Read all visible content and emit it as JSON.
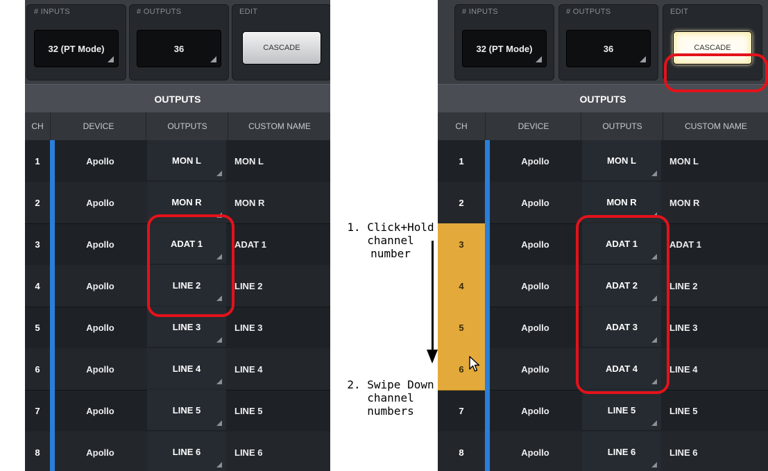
{
  "inputs": {
    "label": "# INPUTS",
    "value": "32 (PT Mode)"
  },
  "outputs_box": {
    "label": "# OUTPUTS",
    "value": "36"
  },
  "edit": {
    "label": "EDIT",
    "button": "CASCADE"
  },
  "section_title": "OUTPUTS",
  "columns": [
    "CH",
    "DEVICE",
    "OUTPUTS",
    "CUSTOM NAME"
  ],
  "before_rows": [
    {
      "ch": "1",
      "device": "Apollo",
      "output": "MON L",
      "custom": "MON L"
    },
    {
      "ch": "2",
      "device": "Apollo",
      "output": "MON R",
      "custom": "MON R"
    },
    {
      "ch": "3",
      "device": "Apollo",
      "output": "ADAT 1",
      "custom": "ADAT 1"
    },
    {
      "ch": "4",
      "device": "Apollo",
      "output": "LINE 2",
      "custom": "LINE 2"
    },
    {
      "ch": "5",
      "device": "Apollo",
      "output": "LINE 3",
      "custom": "LINE 3"
    },
    {
      "ch": "6",
      "device": "Apollo",
      "output": "LINE 4",
      "custom": "LINE 4"
    },
    {
      "ch": "7",
      "device": "Apollo",
      "output": "LINE 5",
      "custom": "LINE 5"
    },
    {
      "ch": "8",
      "device": "Apollo",
      "output": "LINE 6",
      "custom": "LINE 6"
    }
  ],
  "after_rows": [
    {
      "ch": "1",
      "device": "Apollo",
      "output": "MON L",
      "custom": "MON L"
    },
    {
      "ch": "2",
      "device": "Apollo",
      "output": "MON R",
      "custom": "MON R"
    },
    {
      "ch": "3",
      "device": "Apollo",
      "output": "ADAT 1",
      "custom": "ADAT 1"
    },
    {
      "ch": "4",
      "device": "Apollo",
      "output": "ADAT 2",
      "custom": "LINE 2"
    },
    {
      "ch": "5",
      "device": "Apollo",
      "output": "ADAT 3",
      "custom": "LINE 3"
    },
    {
      "ch": "6",
      "device": "Apollo",
      "output": "ADAT 4",
      "custom": "LINE 4"
    },
    {
      "ch": "7",
      "device": "Apollo",
      "output": "LINE 5",
      "custom": "LINE 5"
    },
    {
      "ch": "8",
      "device": "Apollo",
      "output": "LINE 6",
      "custom": "LINE 6"
    }
  ],
  "annotations": {
    "step1": [
      "1. Click+Hold",
      "channel",
      "number"
    ],
    "step2": [
      "2. Swipe Down",
      "channel",
      "numbers"
    ]
  },
  "colors": {
    "accent_blue": "#2a7fd8",
    "highlight": "#e3a93a",
    "callout_red": "#e3121b"
  }
}
